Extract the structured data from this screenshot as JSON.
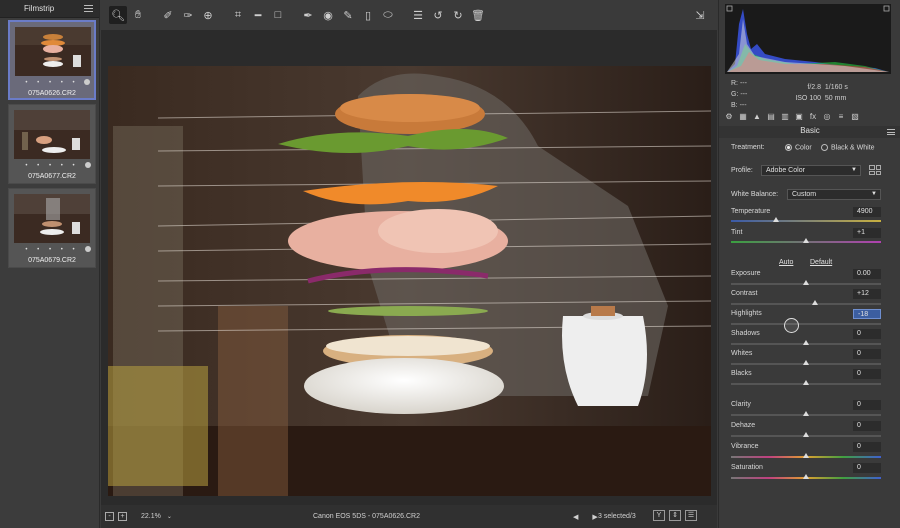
{
  "filmstrip": {
    "title": "Filmstrip",
    "items": [
      {
        "filename": "075A0626.CR2",
        "stars": "• • • • •",
        "selected": true
      },
      {
        "filename": "075A0677.CR2",
        "stars": "• • • • •",
        "selected": false
      },
      {
        "filename": "075A0679.CR2",
        "stars": "• • • • •",
        "selected": false
      }
    ]
  },
  "toolbar": {
    "tools": [
      "zoom-icon",
      "hand-icon",
      "white-balance-icon",
      "color-sampler-icon",
      "target-adjust-icon",
      "crop-icon",
      "straighten-icon",
      "transform-icon",
      "spot-removal-icon",
      "red-eye-icon",
      "adjustment-brush-icon",
      "graduated-filter-icon",
      "radial-filter-icon",
      "preferences-icon",
      "rotate-left-icon",
      "rotate-right-icon",
      "trash-icon"
    ]
  },
  "statusbar": {
    "zoom_minus": "-",
    "zoom_plus": "+",
    "zoom": "22.1%",
    "zoom_caret": "⌄",
    "file_info": "Canon EOS 5DS  -  075A0626.CR2",
    "nav": "◀ ▶",
    "selection": "3 selected/3",
    "btn_y": "Y",
    "btn_compare": "⇕",
    "btn_settings": "☰"
  },
  "readout": {
    "r_label": "R:",
    "r_val": "---",
    "g_label": "G:",
    "g_val": "---",
    "b_label": "B:",
    "b_val": "---",
    "aperture": "f/2.8",
    "shutter": "1/160 s",
    "iso": "ISO 100",
    "focal": "50 mm"
  },
  "panel": {
    "title": "Basic",
    "treatment_label": "Treatment:",
    "treatment_color": "Color",
    "treatment_bw": "Black & White",
    "profile_label": "Profile:",
    "profile_value": "Adobe Color",
    "wb_label": "White Balance:",
    "wb_value": "Custom",
    "auto": "Auto",
    "default": "Default",
    "sliders": {
      "temperature": {
        "label": "Temperature",
        "value": "4900",
        "position": 0.3
      },
      "tint": {
        "label": "Tint",
        "value": "+1",
        "position": 0.5
      },
      "exposure": {
        "label": "Exposure",
        "value": "0.00",
        "position": 0.5
      },
      "contrast": {
        "label": "Contrast",
        "value": "+12",
        "position": 0.56
      },
      "highlights": {
        "label": "Highlights",
        "value": "-18",
        "position": 0.41
      },
      "shadows": {
        "label": "Shadows",
        "value": "0",
        "position": 0.5
      },
      "whites": {
        "label": "Whites",
        "value": "0",
        "position": 0.5
      },
      "blacks": {
        "label": "Blacks",
        "value": "0",
        "position": 0.5
      },
      "clarity": {
        "label": "Clarity",
        "value": "0",
        "position": 0.5
      },
      "dehaze": {
        "label": "Dehaze",
        "value": "0",
        "position": 0.5
      },
      "vibrance": {
        "label": "Vibrance",
        "value": "0",
        "position": 0.5
      },
      "saturation": {
        "label": "Saturation",
        "value": "0",
        "position": 0.5
      }
    }
  },
  "colors": {
    "accent": "#6b7cc8",
    "active_value": "#3c5ea0",
    "background": "#3a3a3a"
  }
}
